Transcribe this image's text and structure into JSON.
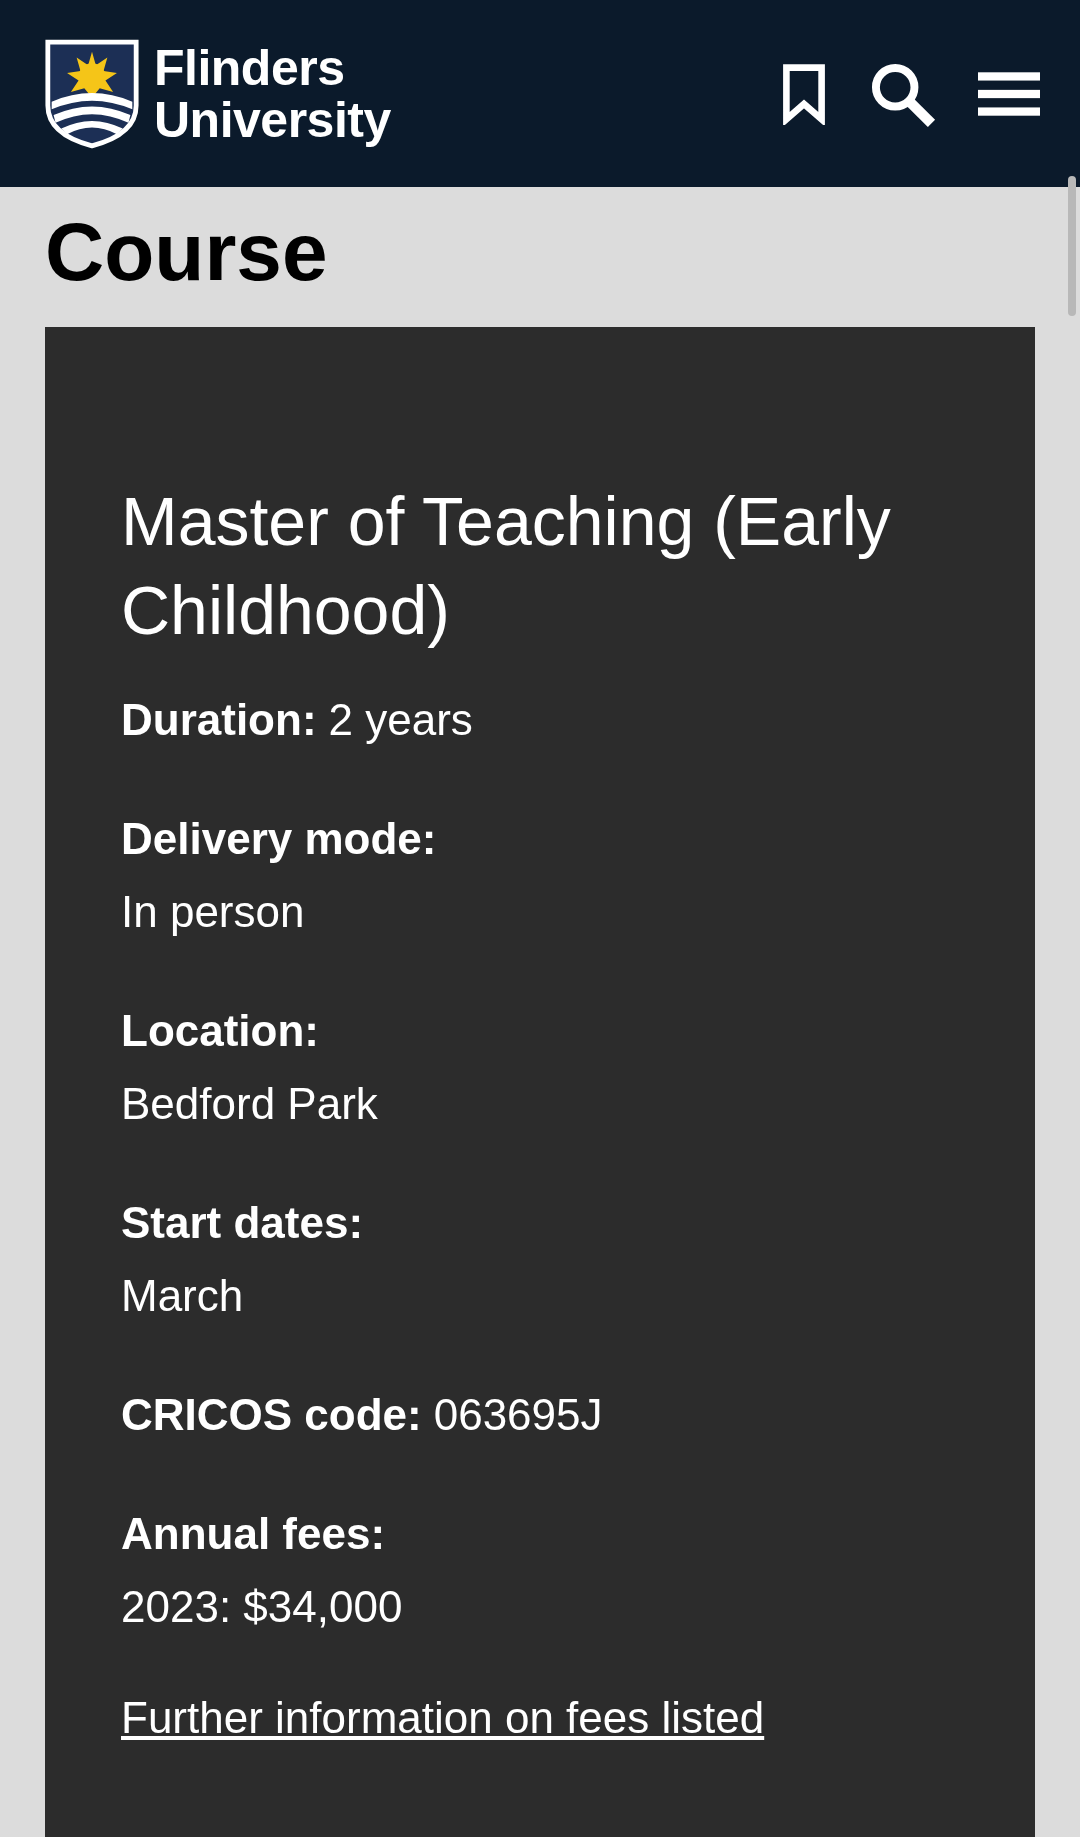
{
  "header": {
    "logo_lines": [
      "Flinders",
      "University"
    ]
  },
  "page_title": "Course",
  "course": {
    "title": "Master of Teaching (Early Childhood)",
    "facts": [
      {
        "kind": "inline",
        "label": "Duration:",
        "value": "2 years"
      },
      {
        "kind": "stacked",
        "label": "Delivery mode:",
        "value": "In person"
      },
      {
        "kind": "stacked",
        "label": "Location:",
        "value": "Bedford Park"
      },
      {
        "kind": "stacked",
        "label": "Start dates:",
        "value": "March"
      },
      {
        "kind": "inline",
        "label": "CRICOS code:",
        "value": "063695J"
      },
      {
        "kind": "stacked",
        "label": "Annual fees:",
        "value": "2023: $34,000"
      }
    ],
    "link": "Further information on fees listed"
  }
}
